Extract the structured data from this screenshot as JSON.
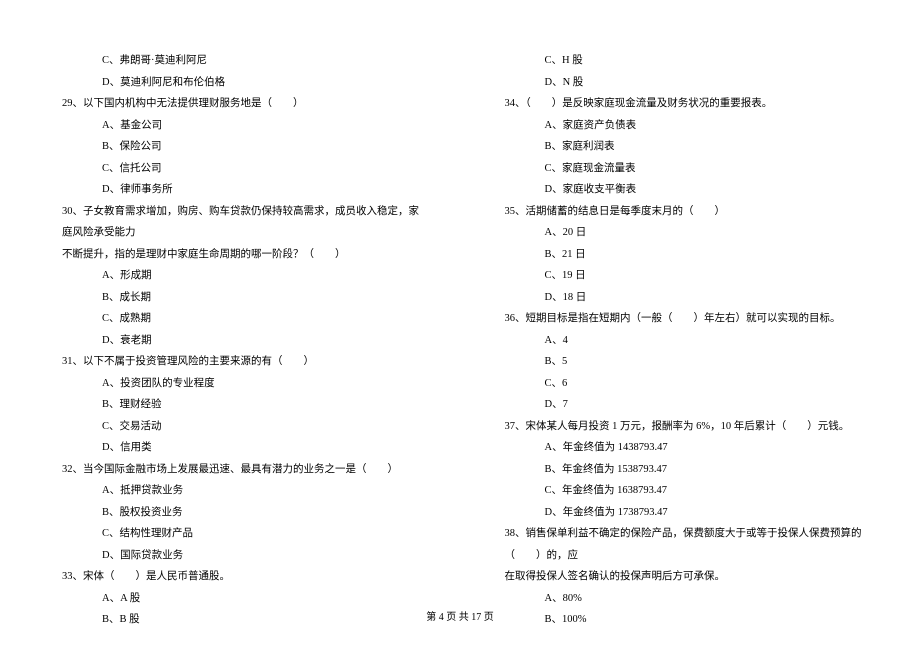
{
  "left_column": {
    "items": [
      {
        "type": "option",
        "text": "C、弗朗哥·莫迪利阿尼"
      },
      {
        "type": "option",
        "text": "D、莫迪利阿尼和布伦伯格"
      },
      {
        "type": "question",
        "text": "29、以下国内机构中无法提供理财服务地是（　　）"
      },
      {
        "type": "option",
        "text": "A、基金公司"
      },
      {
        "type": "option",
        "text": "B、保险公司"
      },
      {
        "type": "option",
        "text": "C、信托公司"
      },
      {
        "type": "option",
        "text": "D、律师事务所"
      },
      {
        "type": "question",
        "text": "30、子女教育需求增加，购房、购车贷款仍保持较高需求，成员收入稳定，家庭风险承受能力"
      },
      {
        "type": "question-cont",
        "text": "不断提升，指的是理财中家庭生命周期的哪一阶段？（　　）"
      },
      {
        "type": "option",
        "text": "A、形成期"
      },
      {
        "type": "option",
        "text": "B、成长期"
      },
      {
        "type": "option",
        "text": "C、成熟期"
      },
      {
        "type": "option",
        "text": "D、衰老期"
      },
      {
        "type": "question",
        "text": "31、以下不属于投资管理风险的主要来源的有（　　）"
      },
      {
        "type": "option",
        "text": "A、投资团队的专业程度"
      },
      {
        "type": "option",
        "text": "B、理财经验"
      },
      {
        "type": "option",
        "text": "C、交易活动"
      },
      {
        "type": "option",
        "text": "D、信用类"
      },
      {
        "type": "question",
        "text": "32、当今国际金融市场上发展最迅速、最具有潜力的业务之一是（　　）"
      },
      {
        "type": "option",
        "text": "A、抵押贷款业务"
      },
      {
        "type": "option",
        "text": "B、股权投资业务"
      },
      {
        "type": "option",
        "text": "C、结构性理财产品"
      },
      {
        "type": "option",
        "text": "D、国际贷款业务"
      },
      {
        "type": "question",
        "text": "33、宋体（　　）是人民币普通股。"
      },
      {
        "type": "option",
        "text": "A、A 股"
      },
      {
        "type": "option",
        "text": "B、B 股"
      }
    ]
  },
  "right_column": {
    "items": [
      {
        "type": "option",
        "text": "C、H 股"
      },
      {
        "type": "option",
        "text": "D、N 股"
      },
      {
        "type": "question",
        "text": "34、（　　）是反映家庭现金流量及财务状况的重要报表。"
      },
      {
        "type": "option",
        "text": "A、家庭资产负债表"
      },
      {
        "type": "option",
        "text": "B、家庭利润表"
      },
      {
        "type": "option",
        "text": "C、家庭现金流量表"
      },
      {
        "type": "option",
        "text": "D、家庭收支平衡表"
      },
      {
        "type": "question",
        "text": "35、活期储蓄的结息日是每季度末月的（　　）"
      },
      {
        "type": "option",
        "text": "A、20 日"
      },
      {
        "type": "option",
        "text": "B、21 日"
      },
      {
        "type": "option",
        "text": "C、19 日"
      },
      {
        "type": "option",
        "text": "D、18 日"
      },
      {
        "type": "question",
        "text": "36、短期目标是指在短期内（一般（　　）年左右）就可以实现的目标。"
      },
      {
        "type": "option",
        "text": "A、4"
      },
      {
        "type": "option",
        "text": "B、5"
      },
      {
        "type": "option",
        "text": "C、6"
      },
      {
        "type": "option",
        "text": "D、7"
      },
      {
        "type": "question",
        "text": "37、宋体某人每月投资 1 万元，报酬率为 6%，10 年后累计（　　）元钱。"
      },
      {
        "type": "option",
        "text": "A、年金终值为 1438793.47"
      },
      {
        "type": "option",
        "text": "B、年金终值为 1538793.47"
      },
      {
        "type": "option",
        "text": "C、年金终值为 1638793.47"
      },
      {
        "type": "option",
        "text": "D、年金终值为 1738793.47"
      },
      {
        "type": "question",
        "text": "38、销售保单利益不确定的保险产品，保费额度大于或等于投保人保费预算的（　　）的，应"
      },
      {
        "type": "question-cont",
        "text": "在取得投保人签名确认的投保声明后方可承保。"
      },
      {
        "type": "option",
        "text": "A、80%"
      },
      {
        "type": "option",
        "text": "B、100%"
      }
    ]
  },
  "footer": {
    "text": "第 4 页 共 17 页"
  }
}
